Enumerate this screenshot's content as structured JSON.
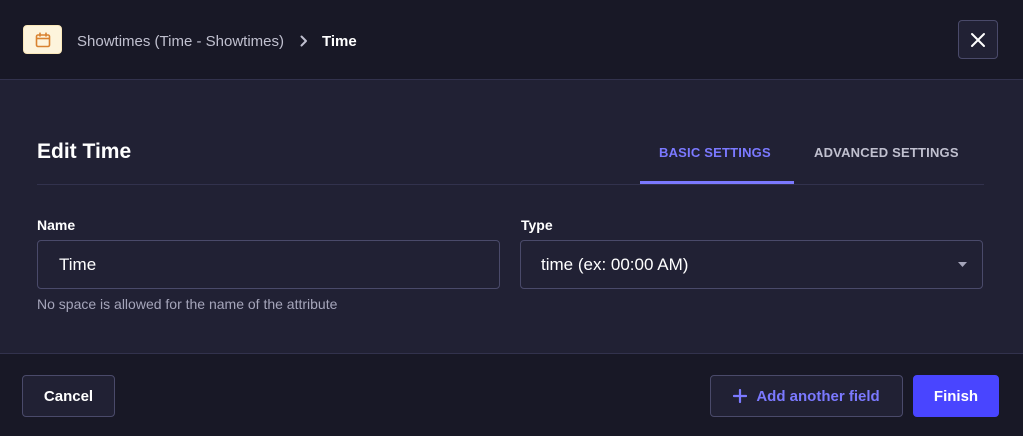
{
  "header": {
    "icon": "calendar-icon",
    "breadcrumb": {
      "parent": "Showtimes (Time - Showtimes)",
      "current": "Time"
    },
    "close_icon": "close-icon"
  },
  "main": {
    "title": "Edit Time",
    "tabs": [
      {
        "label": "BASIC SETTINGS",
        "active": true
      },
      {
        "label": "ADVANCED SETTINGS",
        "active": false
      }
    ],
    "fields": {
      "name": {
        "label": "Name",
        "value": "Time",
        "hint": "No space is allowed for the name of the attribute"
      },
      "type": {
        "label": "Type",
        "value": "time (ex: 00:00 AM)"
      }
    }
  },
  "footer": {
    "cancel_label": "Cancel",
    "add_field_label": "Add another field",
    "finish_label": "Finish"
  },
  "colors": {
    "background": "#212134",
    "header_bg": "#181826",
    "accent": "#7b79ff",
    "primary": "#4945ff",
    "calendar_badge": "#fdf4dc",
    "calendar_icon": "#d9822f"
  }
}
